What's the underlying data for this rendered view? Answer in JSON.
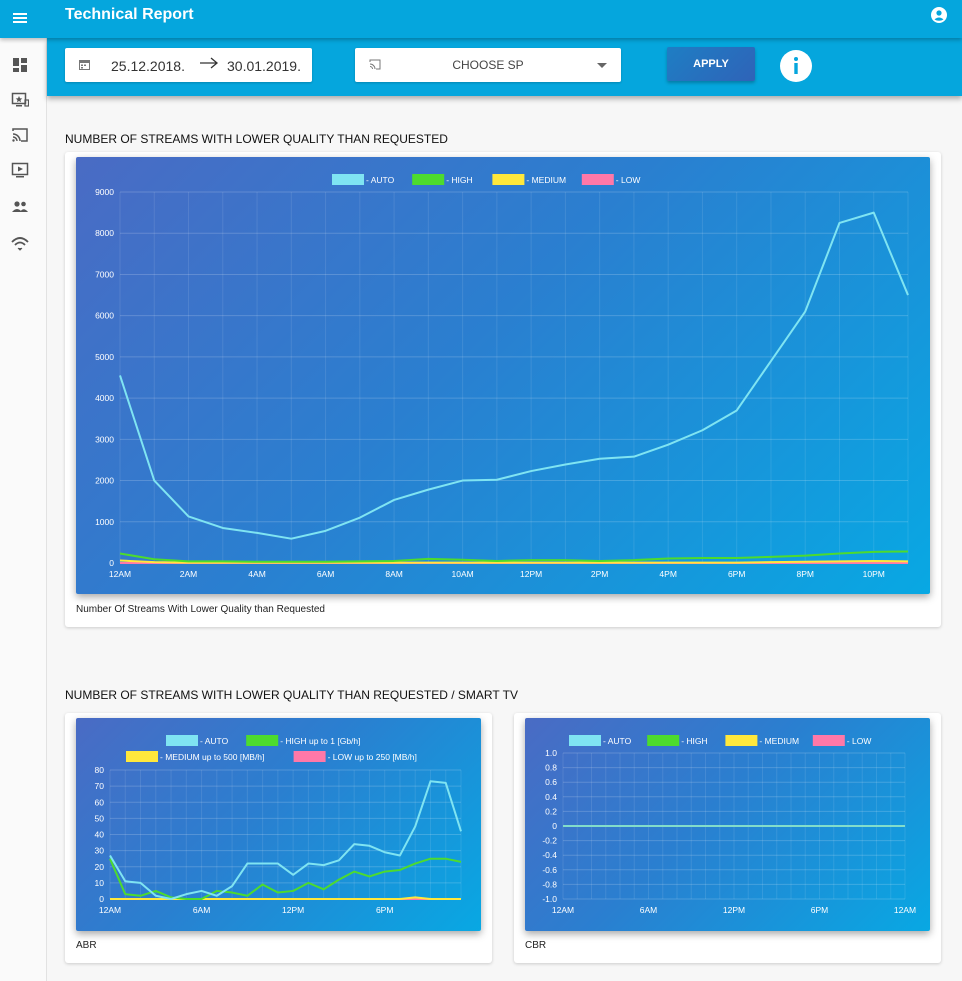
{
  "app": {
    "title": "Technical Report"
  },
  "filters": {
    "date_from": "25.12.2018.",
    "date_to": "30.01.2019.",
    "sp_placeholder": "CHOOSE SP",
    "apply_label": "APPLY"
  },
  "sidebar": {
    "items": [
      {
        "icon": "dashboard-icon"
      },
      {
        "icon": "tv-star-icon"
      },
      {
        "icon": "cast-icon"
      },
      {
        "icon": "play-screen-icon"
      },
      {
        "icon": "users-icon"
      },
      {
        "icon": "wifi-signal-icon"
      }
    ]
  },
  "section1": {
    "title": "NUMBER OF STREAMS WITH LOWER QUALITY THAN REQUESTED",
    "caption": "Number Of Streams With Lower Quality than Requested"
  },
  "section2": {
    "title": "NUMBER OF STREAMS WITH LOWER QUALITY THAN REQUESTED / SMART TV",
    "caption_abr": "ABR",
    "caption_cbr": "CBR"
  },
  "colors": {
    "topbar": "#05a6dd",
    "auto": "#7fe4f2",
    "high": "#4ddb2e",
    "medium": "#ffe83c",
    "low": "#ff78a8"
  },
  "chart_data": [
    {
      "type": "line",
      "ylim": [
        0,
        9000
      ],
      "y_ticks": [
        0,
        1000,
        2000,
        3000,
        4000,
        5000,
        6000,
        7000,
        8000,
        9000
      ],
      "x_tick_labels": [
        "12AM",
        "2AM",
        "4AM",
        "6AM",
        "8AM",
        "10AM",
        "12PM",
        "2PM",
        "4PM",
        "6PM",
        "8PM",
        "10PM"
      ],
      "x": [
        0,
        1,
        2,
        3,
        4,
        5,
        6,
        7,
        8,
        9,
        10,
        11,
        12,
        13,
        14,
        15,
        16,
        17,
        18,
        19,
        20,
        21,
        22,
        23
      ],
      "series": [
        {
          "name": " - AUTO",
          "color": "#7fe4f2",
          "values": [
            4550,
            2000,
            1130,
            850,
            730,
            590,
            780,
            1100,
            1530,
            1780,
            2000,
            2020,
            2230,
            2390,
            2530,
            2580,
            2870,
            3220,
            3700,
            4900,
            6100,
            8250,
            8500,
            6500
          ]
        },
        {
          "name": " - HIGH",
          "color": "#4ddb2e",
          "values": [
            230,
            90,
            40,
            40,
            30,
            30,
            30,
            40,
            50,
            100,
            80,
            50,
            70,
            70,
            50,
            70,
            110,
            120,
            120,
            150,
            180,
            230,
            270,
            280
          ]
        },
        {
          "name": " - MEDIUM",
          "color": "#ffe83c",
          "values": [
            60,
            20,
            10,
            10,
            10,
            10,
            10,
            10,
            10,
            10,
            10,
            10,
            10,
            10,
            10,
            10,
            10,
            10,
            10,
            20,
            30,
            40,
            50,
            40
          ]
        },
        {
          "name": " - LOW",
          "color": "#ff78a8",
          "values": [
            0,
            0,
            0,
            0,
            0,
            0,
            0,
            0,
            0,
            0,
            0,
            0,
            0,
            0,
            0,
            0,
            0,
            0,
            0,
            0,
            0,
            0,
            0,
            0
          ]
        }
      ]
    },
    {
      "type": "line",
      "ylim": [
        0,
        80
      ],
      "y_ticks": [
        0,
        10,
        20,
        30,
        40,
        50,
        60,
        70,
        80
      ],
      "x_tick_labels": [
        "12AM",
        "6AM",
        "12PM",
        "6PM"
      ],
      "x": [
        0,
        1,
        2,
        3,
        4,
        5,
        6,
        7,
        8,
        9,
        10,
        11,
        12,
        13,
        14,
        15,
        16,
        17,
        18,
        19,
        20,
        21,
        22,
        23
      ],
      "series": [
        {
          "name": " - AUTO",
          "color": "#7fe4f2",
          "values": [
            27,
            11,
            10,
            2,
            0,
            3,
            5,
            2,
            8,
            22,
            22,
            22,
            15,
            22,
            21,
            24,
            34,
            33,
            29,
            27,
            45,
            73,
            72,
            42
          ]
        },
        {
          "name": " - HIGH up to 1 [Gb/h]",
          "color": "#4ddb2e",
          "values": [
            25,
            3,
            2,
            5,
            1,
            0,
            0,
            5,
            4,
            2,
            9,
            4,
            5,
            10,
            6,
            12,
            17,
            14,
            17,
            18,
            22,
            25,
            25,
            23
          ]
        },
        {
          "name": " - MEDIUM up to 500 [MB/h]",
          "color": "#ffe83c",
          "values": [
            0,
            0,
            0,
            0,
            0,
            0,
            0,
            0,
            0,
            0,
            0,
            0,
            0,
            0,
            0,
            0,
            0,
            0,
            0,
            0,
            1,
            0,
            0,
            0
          ]
        },
        {
          "name": " - LOW up to 250 [MB/h]",
          "color": "#ff78a8",
          "values": [
            0,
            0,
            0,
            0,
            0,
            0,
            0,
            0,
            0,
            0,
            0,
            0,
            0,
            0,
            0,
            0,
            0,
            0,
            0,
            0,
            0,
            0,
            0,
            0
          ]
        }
      ]
    },
    {
      "type": "line",
      "ylim": [
        -1.0,
        1.0
      ],
      "y_ticks": [
        -1.0,
        -0.8,
        -0.6,
        -0.4,
        -0.2,
        0,
        0.2,
        0.4,
        0.6,
        0.8,
        1.0
      ],
      "y_tick_labels": [
        "-1.0",
        "-0.8",
        "-0.6",
        "-0.4",
        "-0.2",
        "0",
        "0.2",
        "0.4",
        "0.6",
        "0.8",
        "1.0"
      ],
      "x_tick_labels": [
        "12AM",
        "6AM",
        "12PM",
        "6PM",
        "12AM"
      ],
      "x": [
        0,
        1,
        2,
        3,
        4,
        5,
        6,
        7,
        8,
        9,
        10,
        11,
        12,
        13,
        14,
        15,
        16,
        17,
        18,
        19,
        20,
        21,
        22,
        23,
        24
      ],
      "series": [
        {
          "name": " - AUTO",
          "color": "#7fe4f2",
          "values": [
            0,
            0,
            0,
            0,
            0,
            0,
            0,
            0,
            0,
            0,
            0,
            0,
            0,
            0,
            0,
            0,
            0,
            0,
            0,
            0,
            0,
            0,
            0,
            0,
            0
          ]
        },
        {
          "name": " - HIGH",
          "color": "#4ddb2e",
          "values": [
            0,
            0,
            0,
            0,
            0,
            0,
            0,
            0,
            0,
            0,
            0,
            0,
            0,
            0,
            0,
            0,
            0,
            0,
            0,
            0,
            0,
            0,
            0,
            0,
            0
          ]
        },
        {
          "name": " - MEDIUM",
          "color": "#ffe83c",
          "values": [
            0,
            0,
            0,
            0,
            0,
            0,
            0,
            0,
            0,
            0,
            0,
            0,
            0,
            0,
            0,
            0,
            0,
            0,
            0,
            0,
            0,
            0,
            0,
            0,
            0
          ]
        },
        {
          "name": " - LOW",
          "color": "#ff78a8",
          "values": [
            0,
            0,
            0,
            0,
            0,
            0,
            0,
            0,
            0,
            0,
            0,
            0,
            0,
            0,
            0,
            0,
            0,
            0,
            0,
            0,
            0,
            0,
            0,
            0,
            0
          ]
        }
      ]
    }
  ]
}
